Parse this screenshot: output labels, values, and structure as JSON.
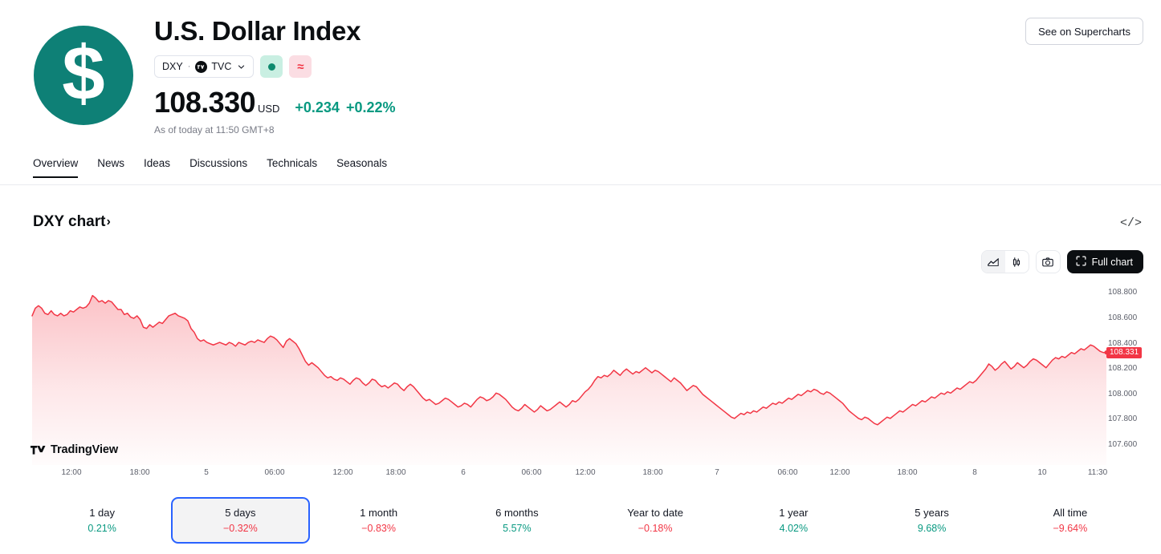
{
  "header": {
    "logo_symbol": "$",
    "logo_color": "#0e8076",
    "title": "U.S. Dollar Index",
    "symbol_pill": {
      "ticker": "DXY",
      "separator": "·",
      "exchange": "TVC",
      "chevron": "chevron-down"
    },
    "badges": {
      "market_status": "open",
      "approx_label": "≈"
    },
    "price": "108.330",
    "currency": "USD",
    "change_abs": "+0.234",
    "change_pct": "+0.22%",
    "change_color": "#089981",
    "as_of": "As of today at 11:50 GMT+8",
    "supercharts_button": "See on Supercharts"
  },
  "tabs": [
    {
      "label": "Overview",
      "active": true
    },
    {
      "label": "News",
      "active": false
    },
    {
      "label": "Ideas",
      "active": false
    },
    {
      "label": "Discussions",
      "active": false
    },
    {
      "label": "Technicals",
      "active": false
    },
    {
      "label": "Seasonals",
      "active": false
    }
  ],
  "chart_section": {
    "title": "DXY chart",
    "title_arrow": "›",
    "embed_code_icon": "</>",
    "toolbar": {
      "area_chart_label": "area-chart",
      "candles_label": "candles-chart",
      "snapshot_label": "camera",
      "full_chart_label": "Full chart"
    },
    "watermark": "TradingView"
  },
  "chart_data": {
    "type": "area",
    "title": "DXY chart",
    "series_name": "DXY",
    "line_color": "#f23645",
    "fill_top_color": "rgba(242, 54, 69, 0.28)",
    "fill_bottom_color": "rgba(242, 54, 69, 0.02)",
    "grid": false,
    "legend": "none",
    "ylabel": "",
    "xlabel": "",
    "ylim": [
      107.48,
      108.86
    ],
    "y_ticks": [
      "108.800",
      "108.600",
      "108.400",
      "108.200",
      "108.000",
      "107.800",
      "107.600"
    ],
    "y_tick_values": [
      108.8,
      108.6,
      108.4,
      108.2,
      108.0,
      107.8,
      107.6
    ],
    "x_ticks": [
      "12:00",
      "18:00",
      "5",
      "06:00",
      "12:00",
      "18:00",
      "6",
      "06:00",
      "12:00",
      "18:00",
      "7",
      "06:00",
      "12:00",
      "18:00",
      "8",
      "10",
      "11:30"
    ],
    "last_price_tag": "108.331",
    "last_price_tag_color": "#f23645",
    "values": [
      108.62,
      108.68,
      108.7,
      108.68,
      108.64,
      108.63,
      108.66,
      108.63,
      108.62,
      108.64,
      108.62,
      108.63,
      108.66,
      108.65,
      108.67,
      108.69,
      108.68,
      108.69,
      108.72,
      108.78,
      108.76,
      108.73,
      108.74,
      108.72,
      108.74,
      108.73,
      108.7,
      108.67,
      108.67,
      108.63,
      108.64,
      108.61,
      108.6,
      108.62,
      108.59,
      108.53,
      108.52,
      108.55,
      108.53,
      108.55,
      108.57,
      108.56,
      108.59,
      108.62,
      108.63,
      108.64,
      108.62,
      108.61,
      108.6,
      108.58,
      108.52,
      108.49,
      108.44,
      108.42,
      108.43,
      108.41,
      108.4,
      108.39,
      108.4,
      108.41,
      108.4,
      108.39,
      108.41,
      108.4,
      108.38,
      108.41,
      108.4,
      108.39,
      108.41,
      108.42,
      108.41,
      108.43,
      108.42,
      108.41,
      108.44,
      108.46,
      108.45,
      108.43,
      108.4,
      108.37,
      108.42,
      108.44,
      108.42,
      108.4,
      108.36,
      108.31,
      108.26,
      108.23,
      108.25,
      108.23,
      108.21,
      108.18,
      108.15,
      108.13,
      108.14,
      108.12,
      108.11,
      108.13,
      108.12,
      108.1,
      108.08,
      108.11,
      108.13,
      108.12,
      108.09,
      108.07,
      108.09,
      108.12,
      108.11,
      108.08,
      108.06,
      108.07,
      108.05,
      108.07,
      108.09,
      108.08,
      108.05,
      108.03,
      108.06,
      108.08,
      108.06,
      108.03,
      108.0,
      107.97,
      107.95,
      107.96,
      107.94,
      107.92,
      107.93,
      107.95,
      107.97,
      107.96,
      107.94,
      107.92,
      107.9,
      107.91,
      107.93,
      107.92,
      107.9,
      107.93,
      107.96,
      107.98,
      107.97,
      107.95,
      107.96,
      107.98,
      108.01,
      108.0,
      107.98,
      107.96,
      107.93,
      107.9,
      107.88,
      107.87,
      107.89,
      107.92,
      107.9,
      107.88,
      107.86,
      107.88,
      107.91,
      107.89,
      107.87,
      107.88,
      107.9,
      107.92,
      107.94,
      107.92,
      107.9,
      107.92,
      107.95,
      107.94,
      107.96,
      107.99,
      108.02,
      108.04,
      108.07,
      108.11,
      108.14,
      108.13,
      108.15,
      108.14,
      108.16,
      108.19,
      108.17,
      108.15,
      108.18,
      108.2,
      108.18,
      108.16,
      108.18,
      108.17,
      108.19,
      108.21,
      108.19,
      108.17,
      108.19,
      108.18,
      108.16,
      108.14,
      108.12,
      108.1,
      108.13,
      108.11,
      108.09,
      108.06,
      108.03,
      108.05,
      108.07,
      108.06,
      108.03,
      108.0,
      107.98,
      107.96,
      107.94,
      107.92,
      107.9,
      107.88,
      107.86,
      107.84,
      107.82,
      107.81,
      107.83,
      107.85,
      107.84,
      107.86,
      107.85,
      107.87,
      107.86,
      107.88,
      107.9,
      107.89,
      107.91,
      107.93,
      107.92,
      107.94,
      107.93,
      107.95,
      107.97,
      107.96,
      107.98,
      108.0,
      107.99,
      108.01,
      108.03,
      108.02,
      108.04,
      108.03,
      108.01,
      108.0,
      108.02,
      108.01,
      107.99,
      107.97,
      107.95,
      107.93,
      107.9,
      107.87,
      107.85,
      107.83,
      107.81,
      107.8,
      107.82,
      107.81,
      107.79,
      107.77,
      107.76,
      107.78,
      107.8,
      107.82,
      107.81,
      107.83,
      107.85,
      107.87,
      107.86,
      107.88,
      107.9,
      107.92,
      107.91,
      107.93,
      107.95,
      107.94,
      107.96,
      107.98,
      107.97,
      107.99,
      108.01,
      108.0,
      108.02,
      108.01,
      108.03,
      108.05,
      108.04,
      108.06,
      108.08,
      108.1,
      108.09,
      108.11,
      108.14,
      108.17,
      108.2,
      108.24,
      108.22,
      108.19,
      108.21,
      108.24,
      108.26,
      108.23,
      108.2,
      108.22,
      108.25,
      108.23,
      108.21,
      108.23,
      108.26,
      108.28,
      108.27,
      108.25,
      108.23,
      108.21,
      108.24,
      108.27,
      108.29,
      108.28,
      108.3,
      108.29,
      108.31,
      108.33,
      108.32,
      108.34,
      108.36,
      108.35,
      108.37,
      108.39,
      108.38,
      108.36,
      108.34,
      108.33,
      108.331
    ]
  },
  "ranges": [
    {
      "label": "1 day",
      "value": "0.21%",
      "dir": "up",
      "selected": false
    },
    {
      "label": "5 days",
      "value": "−0.32%",
      "dir": "down",
      "selected": true
    },
    {
      "label": "1 month",
      "value": "−0.83%",
      "dir": "down",
      "selected": false
    },
    {
      "label": "6 months",
      "value": "5.57%",
      "dir": "up",
      "selected": false
    },
    {
      "label": "Year to date",
      "value": "−0.18%",
      "dir": "down",
      "selected": false
    },
    {
      "label": "1 year",
      "value": "4.02%",
      "dir": "up",
      "selected": false
    },
    {
      "label": "5 years",
      "value": "9.68%",
      "dir": "up",
      "selected": false
    },
    {
      "label": "All time",
      "value": "−9.64%",
      "dir": "down",
      "selected": false
    }
  ]
}
